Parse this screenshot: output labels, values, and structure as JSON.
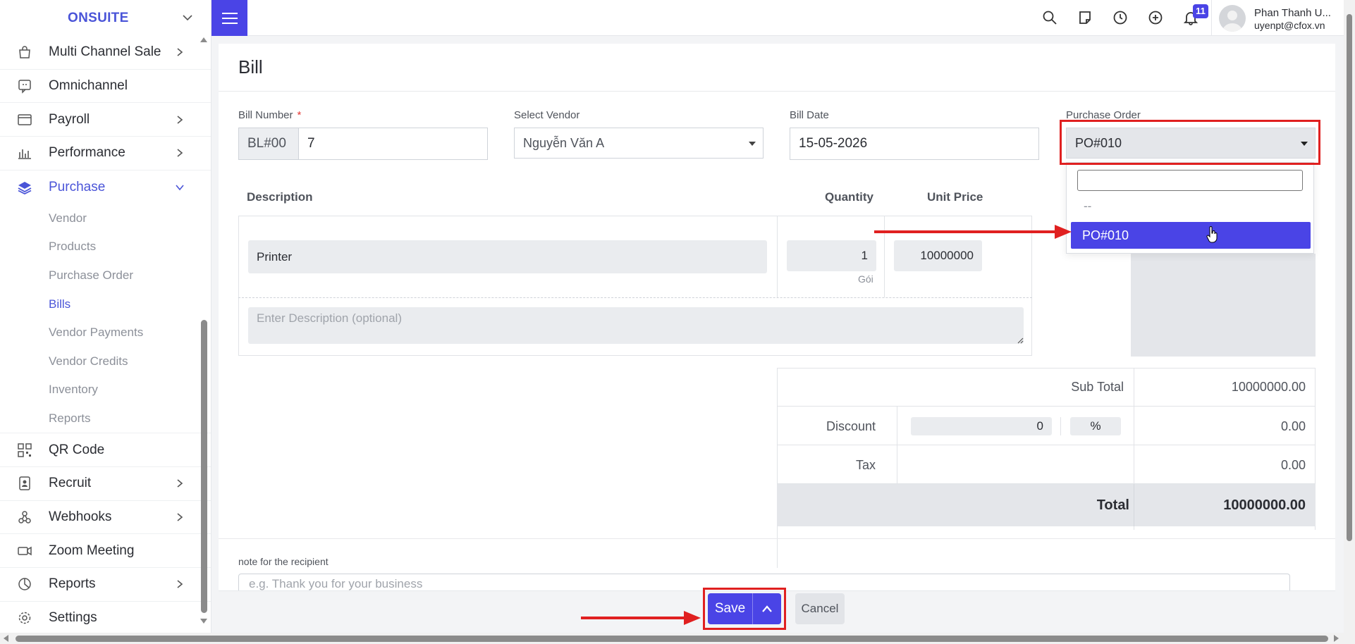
{
  "sidebar": {
    "brand": "ONSUITE",
    "items": [
      {
        "label": "Multi Channel Sale",
        "icon": "bag-icon",
        "has_arrow": true
      },
      {
        "label": "Omnichannel",
        "icon": "chat-icon",
        "has_arrow": false
      },
      {
        "label": "Payroll",
        "icon": "window-icon",
        "has_arrow": true
      },
      {
        "label": "Performance",
        "icon": "bar-chart-icon",
        "has_arrow": true
      },
      {
        "label": "Purchase",
        "icon": "layers-icon",
        "has_arrow": true,
        "expanded": true
      }
    ],
    "purchase_sub": [
      "Vendor",
      "Products",
      "Purchase Order",
      "Bills",
      "Vendor Payments",
      "Vendor Credits",
      "Inventory",
      "Reports"
    ],
    "active_sub": "Bills",
    "items_after": [
      {
        "label": "QR Code",
        "icon": "qr-icon",
        "has_arrow": false
      },
      {
        "label": "Recruit",
        "icon": "badge-icon",
        "has_arrow": true
      },
      {
        "label": "Webhooks",
        "icon": "webhook-icon",
        "has_arrow": true
      },
      {
        "label": "Zoom Meeting",
        "icon": "camera-icon",
        "has_arrow": false
      },
      {
        "label": "Reports",
        "icon": "pie-icon",
        "has_arrow": true
      },
      {
        "label": "Settings",
        "icon": "gear-icon",
        "has_arrow": false
      }
    ]
  },
  "topbar": {
    "notification_count": "11",
    "user_name": "Phan Thanh U...",
    "user_email": "uyenpt@cfox.vn"
  },
  "page": {
    "title": "Bill"
  },
  "form": {
    "bill_number_label": "Bill Number",
    "bill_number_required": "*",
    "bill_prefix": "BL#00",
    "bill_number": "7",
    "vendor_label": "Select Vendor",
    "vendor_value": "Nguyễn Văn A",
    "bill_date_label": "Bill Date",
    "bill_date": "15-05-2026",
    "po_label": "Purchase Order",
    "po_value": "PO#010"
  },
  "dropdown": {
    "options": [
      "--",
      "PO#010"
    ],
    "highlighted": "PO#010"
  },
  "items_table": {
    "headers": {
      "description": "Description",
      "quantity": "Quantity",
      "unit_price": "Unit Price"
    },
    "row": {
      "description": "Printer",
      "quantity": "1",
      "unit": "Gói",
      "unit_price": "10000000"
    },
    "desc_placeholder": "Enter Description (optional)"
  },
  "totals": {
    "sub_total_label": "Sub Total",
    "sub_total": "10000000.00",
    "discount_label": "Discount",
    "discount_input": "0",
    "discount_unit": "%",
    "discount_value": "0.00",
    "tax_label": "Tax",
    "tax_value": "0.00",
    "total_label": "Total",
    "total_value": "10000000.00"
  },
  "note": {
    "label": "note for the recipient",
    "placeholder": "e.g. Thank you for your business"
  },
  "footer": {
    "save_label": "Save",
    "cancel_label": "Cancel"
  }
}
